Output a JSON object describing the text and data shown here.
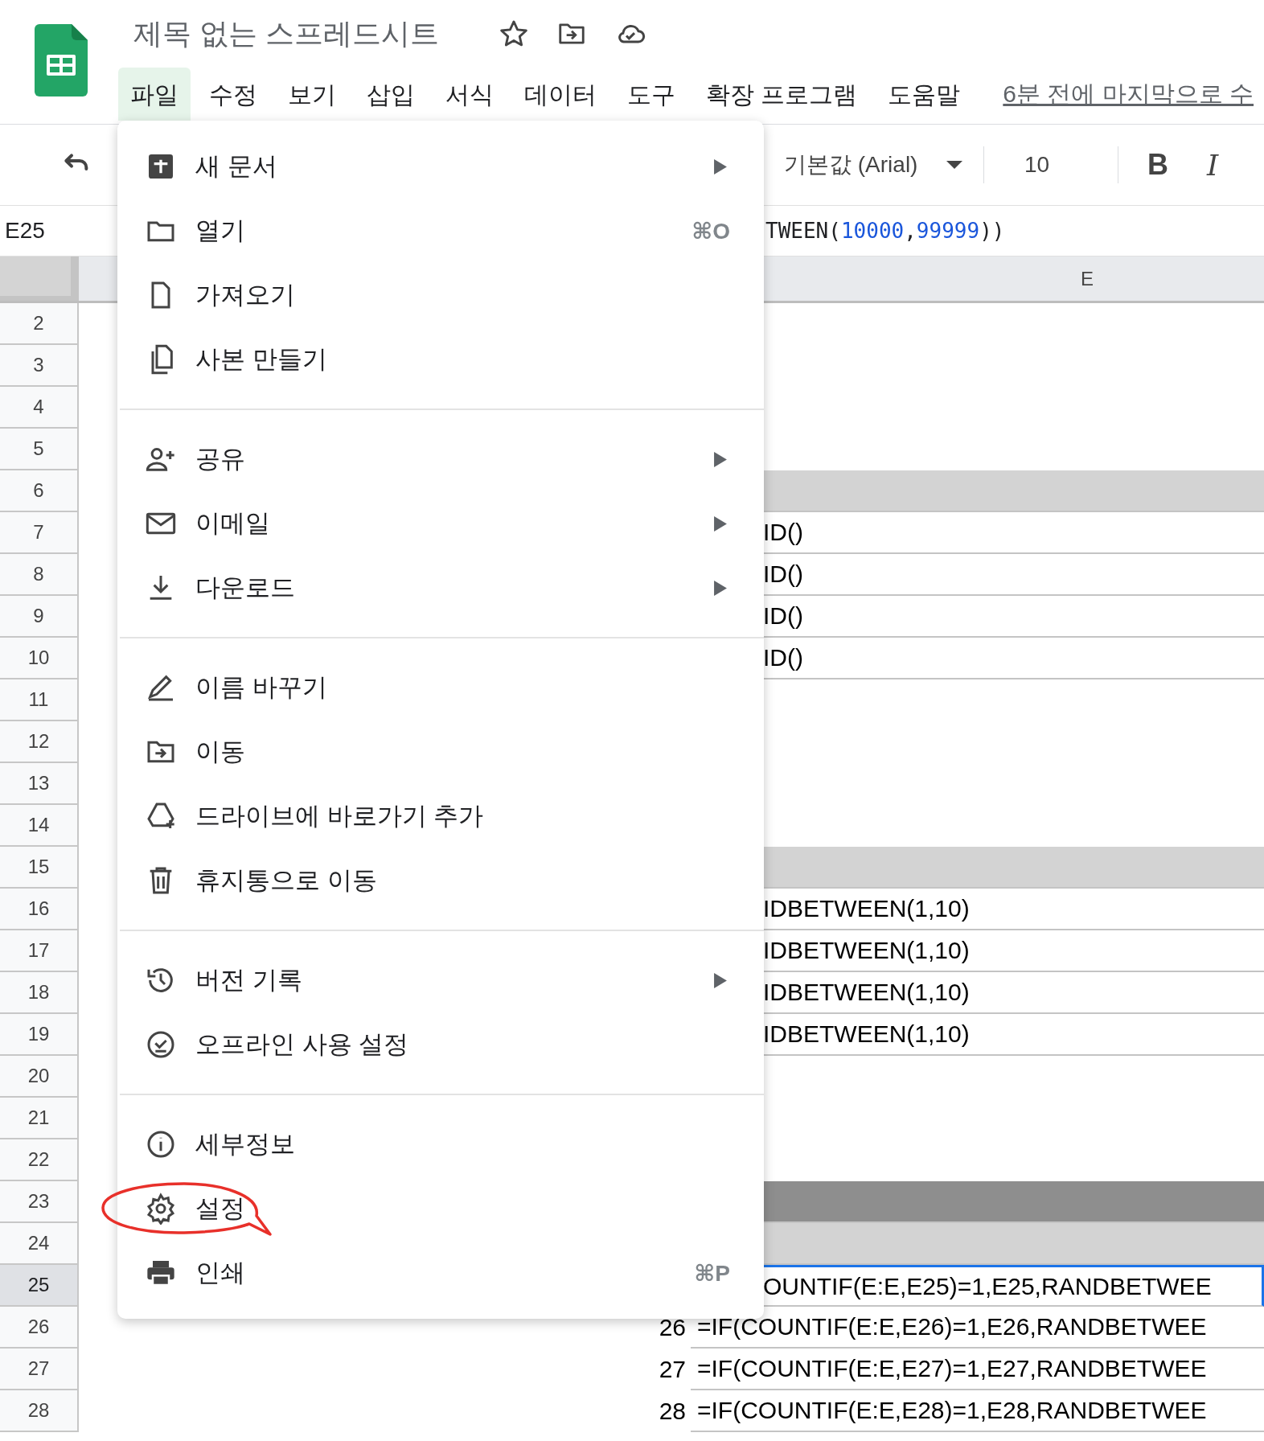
{
  "app": {
    "title": "제목 없는 스프레드시트",
    "last_edit": "6분 전에 마지막으로 수"
  },
  "menubar": [
    {
      "label": "파일",
      "selected": true
    },
    {
      "label": "수정",
      "selected": false
    },
    {
      "label": "보기",
      "selected": false
    },
    {
      "label": "삽입",
      "selected": false
    },
    {
      "label": "서식",
      "selected": false
    },
    {
      "label": "데이터",
      "selected": false
    },
    {
      "label": "도구",
      "selected": false
    },
    {
      "label": "확장 프로그램",
      "selected": false
    },
    {
      "label": "도움말",
      "selected": false
    }
  ],
  "toolbar": {
    "font": "기본값 (Arial)",
    "size": "10",
    "bold": "B",
    "italic": "I"
  },
  "formula_bar": {
    "cell": "E25",
    "formula": "TWEEN(10000,99999))"
  },
  "column_header": "E",
  "rows": [
    {
      "number": "2",
      "selected": false,
      "kind": "plain"
    },
    {
      "number": "3",
      "selected": false,
      "kind": "plain"
    },
    {
      "number": "4",
      "selected": false,
      "kind": "plain"
    },
    {
      "number": "5",
      "selected": false,
      "kind": "plain"
    },
    {
      "number": "6",
      "selected": false,
      "kind": "shaded"
    },
    {
      "number": "7",
      "selected": false,
      "kind": "plain",
      "e": "ID()"
    },
    {
      "number": "8",
      "selected": false,
      "kind": "plain",
      "e": "ID()"
    },
    {
      "number": "9",
      "selected": false,
      "kind": "plain",
      "e": "ID()"
    },
    {
      "number": "10",
      "selected": false,
      "kind": "plain",
      "e": "ID()"
    },
    {
      "number": "11",
      "selected": false,
      "kind": "plain"
    },
    {
      "number": "12",
      "selected": false,
      "kind": "plain"
    },
    {
      "number": "13",
      "selected": false,
      "kind": "plain"
    },
    {
      "number": "14",
      "selected": false,
      "kind": "plain"
    },
    {
      "number": "15",
      "selected": false,
      "kind": "shaded"
    },
    {
      "number": "16",
      "selected": false,
      "kind": "plain",
      "e": "IDBETWEEN(1,10)"
    },
    {
      "number": "17",
      "selected": false,
      "kind": "plain",
      "e": "IDBETWEEN(1,10)"
    },
    {
      "number": "18",
      "selected": false,
      "kind": "plain",
      "e": "IDBETWEEN(1,10)"
    },
    {
      "number": "19",
      "selected": false,
      "kind": "plain",
      "e": "IDBETWEEN(1,10)"
    },
    {
      "number": "20",
      "selected": false,
      "kind": "plain"
    },
    {
      "number": "21",
      "selected": false,
      "kind": "plain"
    },
    {
      "number": "22",
      "selected": false,
      "kind": "plain"
    },
    {
      "number": "23",
      "selected": false,
      "kind": "dark"
    },
    {
      "number": "24",
      "selected": false,
      "kind": "shaded"
    },
    {
      "number": "25",
      "selected": true,
      "kind": "plain",
      "e": "OUNTIF(E:E,E25)=1,E25,RANDBETWEE"
    },
    {
      "number": "26",
      "selected": false,
      "kind": "plain",
      "d": "26",
      "e": "=IF(COUNTIF(E:E,E26)=1,E26,RANDBETWEE"
    },
    {
      "number": "27",
      "selected": false,
      "kind": "plain",
      "d": "27",
      "e": "=IF(COUNTIF(E:E,E27)=1,E27,RANDBETWEE"
    },
    {
      "number": "28",
      "selected": false,
      "kind": "plain",
      "d": "28",
      "e": "=IF(COUNTIF(E:E,E28)=1,E28,RANDBETWEE"
    }
  ],
  "file_menu": {
    "sections": [
      [
        {
          "label": "새 문서",
          "submenu": true,
          "annotated": false
        },
        {
          "label": "열기",
          "shortcut": "⌘O",
          "submenu": false,
          "annotated": false
        },
        {
          "label": "가져오기",
          "submenu": false,
          "annotated": false
        },
        {
          "label": "사본 만들기",
          "submenu": false,
          "annotated": false
        }
      ],
      [
        {
          "label": "공유",
          "submenu": true,
          "annotated": false
        },
        {
          "label": "이메일",
          "submenu": true,
          "annotated": false
        },
        {
          "label": "다운로드",
          "submenu": true,
          "annotated": false
        }
      ],
      [
        {
          "label": "이름 바꾸기",
          "submenu": false,
          "annotated": false
        },
        {
          "label": "이동",
          "submenu": false,
          "annotated": false
        },
        {
          "label": "드라이브에 바로가기 추가",
          "submenu": false,
          "annotated": false
        },
        {
          "label": "휴지통으로 이동",
          "submenu": false,
          "annotated": false
        }
      ],
      [
        {
          "label": "버전 기록",
          "submenu": true,
          "annotated": false
        },
        {
          "label": "오프라인 사용 설정",
          "submenu": false,
          "annotated": false
        }
      ],
      [
        {
          "label": "세부정보",
          "submenu": false,
          "annotated": false
        },
        {
          "label": "설정",
          "submenu": false,
          "annotated": true
        },
        {
          "label": "인쇄",
          "shortcut": "⌘P",
          "submenu": false,
          "annotated": false
        }
      ]
    ]
  }
}
